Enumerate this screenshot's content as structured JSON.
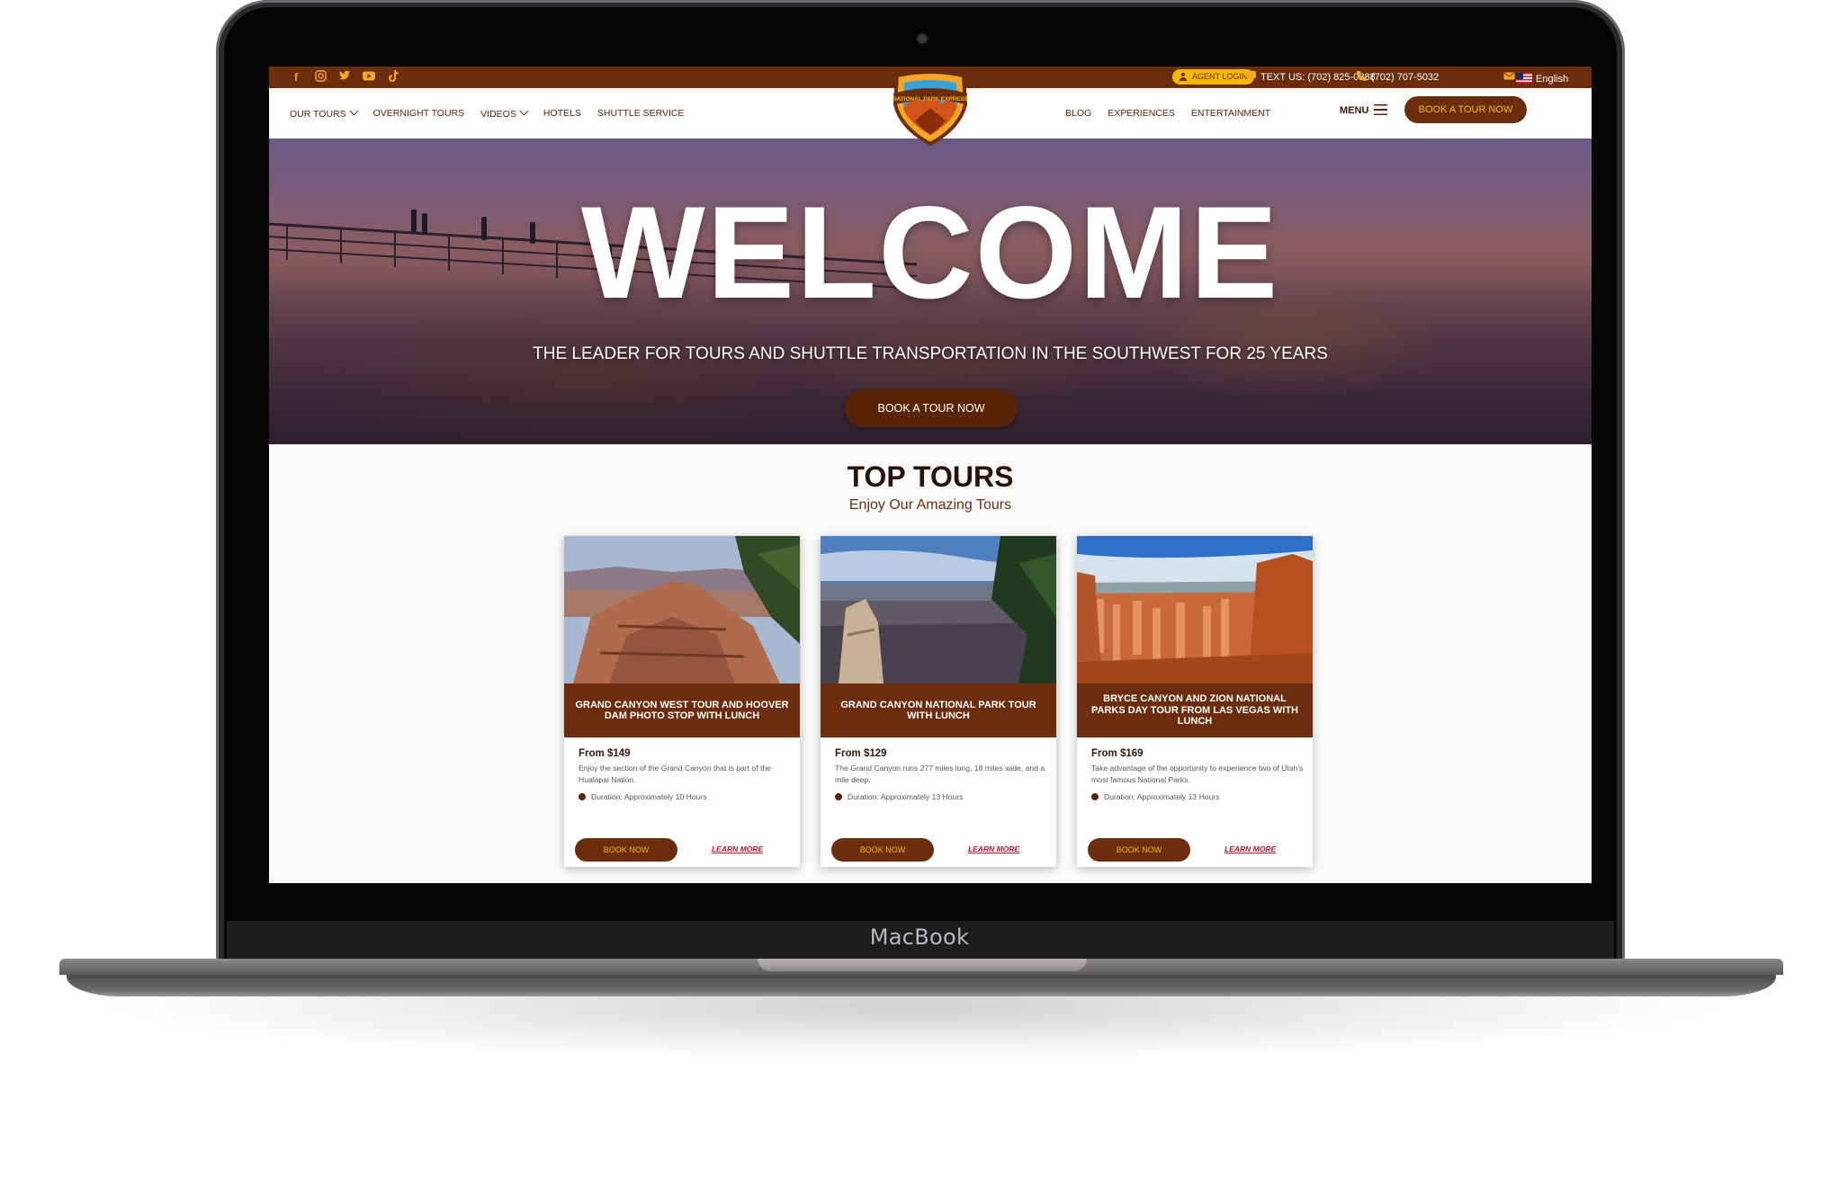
{
  "device": {
    "brand": "MacBook"
  },
  "topbar": {
    "social_icons": [
      "facebook-icon",
      "instagram-icon",
      "twitter-icon",
      "youtube-icon",
      "tiktok-icon"
    ],
    "agent_login": "AGENT LOGIN",
    "text_us": "TEXT US: (702) 825-0388",
    "phone": "(702) 707-5032",
    "language": "English"
  },
  "nav": {
    "left": [
      "OUR TOURS",
      "OVERNIGHT TOURS",
      "VIDEOS",
      "HOTELS",
      "SHUTTLE SERVICE"
    ],
    "right": [
      "BLOG",
      "EXPERIENCES",
      "ENTERTAINMENT"
    ],
    "menu": "MENU",
    "book": "BOOK A TOUR NOW",
    "logo_text": "NATIONAL PARK EXPRESS"
  },
  "hero": {
    "title": "WELCOME",
    "subtitle": "THE LEADER FOR TOURS AND SHUTTLE TRANSPORTATION IN THE SOUTHWEST FOR 25 YEARS",
    "button": "BOOK A TOUR NOW"
  },
  "tours": {
    "title": "TOP TOURS",
    "subtitle": "Enjoy Our Amazing Tours",
    "cards": [
      {
        "title": "GRAND CANYON WEST TOUR AND HOOVER DAM PHOTO STOP WITH LUNCH",
        "price": "From $149",
        "description": "Enjoy the section of the Grand Canyon that is part of the Hualapai Nation.",
        "duration": "Duration: Approximately 10 Hours",
        "book": "BOOK NOW",
        "learn": "LEARN MORE"
      },
      {
        "title": "GRAND CANYON NATIONAL PARK TOUR WITH LUNCH",
        "price": "From $129",
        "description": "The Grand Canyon runs 277 miles long, 18 miles wide, and a mile deep.",
        "duration": "Duration: Approximately 13 Hours",
        "book": "BOOK NOW",
        "learn": "LEARN MORE"
      },
      {
        "title": "BRYCE CANYON AND ZION NATIONAL PARKS DAY TOUR FROM LAS VEGAS WITH LUNCH",
        "price": "From $169",
        "description": "Take advantage of the opportunity to experience two of Utah's most famous National Parks.",
        "duration": "Duration: Approximately 13 Hours",
        "book": "BOOK NOW",
        "learn": "LEARN MORE"
      }
    ]
  },
  "colors": {
    "brand_brown": "#6b2d0c",
    "accent_gold": "#f5b800",
    "link_red": "#c0102e"
  }
}
